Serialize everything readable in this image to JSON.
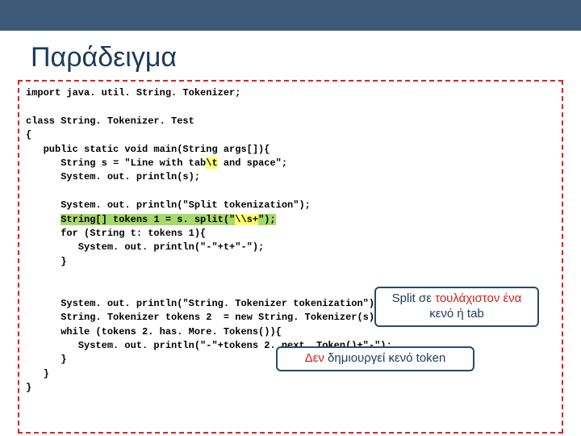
{
  "title": "Παράδειγμα",
  "code": {
    "l1": "import java. util. String. Tokenizer;",
    "l2": "class String. Tokenizer. Test",
    "l3": "{",
    "l4": "   public static void main(String args[]){",
    "l5a": "      String s = \"Line with tab",
    "l5b": "\\t",
    "l5c": " and space\";",
    "l6": "      System. out. println(s);",
    "l7": "      System. out. println(\"Split tokenization\");",
    "l8a": "      ",
    "l8b": "String[] tokens 1 = s. split(\"",
    "l8c": "\\\\s+",
    "l8d": "\");",
    "l9": "      for (String t: tokens 1){",
    "l10": "         System. out. println(\"-\"+t+\"-\");",
    "l11": "      }",
    "l12": "      System. out. println(\"String. Tokenizer tokenization\");",
    "l13": "      String. Tokenizer tokens 2  = new String. Tokenizer(s);",
    "l14": "      while (tokens 2. has. More. Tokens()){",
    "l15": "         System. out. println(\"-\"+tokens 2. next. Token()+\"-\");",
    "l16": "      }",
    "l17": "   }",
    "l18": "}"
  },
  "callouts": {
    "c1_pre": "Split σε ",
    "c1_red": "τουλάχιστον ένα",
    "c1_post": " κενό ή tab",
    "c2_red": "Δεν",
    "c2_post": " δημιουργεί κενό token"
  }
}
